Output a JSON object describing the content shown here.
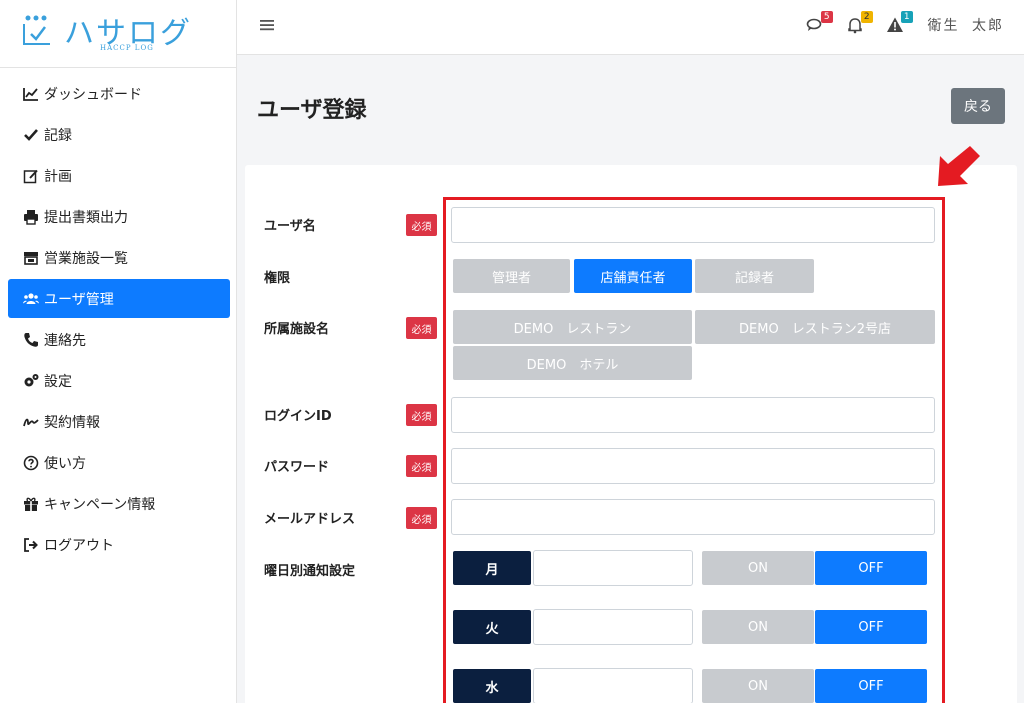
{
  "app": {
    "logo_text": "ハサログ",
    "logo_sub": "HACCP LOG"
  },
  "sidebar": {
    "items": [
      {
        "label": "ダッシュボード",
        "icon": "chart-line-icon"
      },
      {
        "label": "記録",
        "icon": "check-icon"
      },
      {
        "label": "計画",
        "icon": "edit-icon"
      },
      {
        "label": "提出書類出力",
        "icon": "printer-icon"
      },
      {
        "label": "営業施設一覧",
        "icon": "store-icon"
      },
      {
        "label": "ユーザ管理",
        "icon": "users-icon",
        "active": true
      },
      {
        "label": "連絡先",
        "icon": "phone-icon"
      },
      {
        "label": "設定",
        "icon": "gears-icon"
      },
      {
        "label": "契約情報",
        "icon": "signature-icon"
      },
      {
        "label": "使い方",
        "icon": "question-circle-icon"
      },
      {
        "label": "キャンペーン情報",
        "icon": "gift-icon"
      },
      {
        "label": "ログアウト",
        "icon": "sign-out-icon"
      }
    ]
  },
  "topbar": {
    "messages_count": "5",
    "notifications_count": "2",
    "alerts_count": "1",
    "user_name": "衛生 太郎"
  },
  "page": {
    "title": "ユーザ登録",
    "back_label": "戻る"
  },
  "form": {
    "required_label": "必須",
    "username_label": "ユーザ名",
    "role_label": "権限",
    "roles": [
      "管理者",
      "店舗責任者",
      "記録者"
    ],
    "selected_role": "店舗責任者",
    "facility_label": "所属施設名",
    "facilities": [
      "DEMO　レストラン",
      "DEMO　レストラン2号店",
      "DEMO　ホテル"
    ],
    "login_label": "ログインID",
    "password_label": "パスワード",
    "email_label": "メールアドレス",
    "notify_label": "曜日別通知設定",
    "days": [
      {
        "day": "月",
        "on": "ON",
        "off": "OFF",
        "selected": "OFF"
      },
      {
        "day": "火",
        "on": "ON",
        "off": "OFF",
        "selected": "OFF"
      },
      {
        "day": "水",
        "on": "ON",
        "off": "OFF",
        "selected": "OFF"
      }
    ]
  },
  "colors": {
    "accent": "#0d7bff",
    "required": "#dc3545",
    "highlight": "#e41b22",
    "navy": "#0b1f3f"
  }
}
